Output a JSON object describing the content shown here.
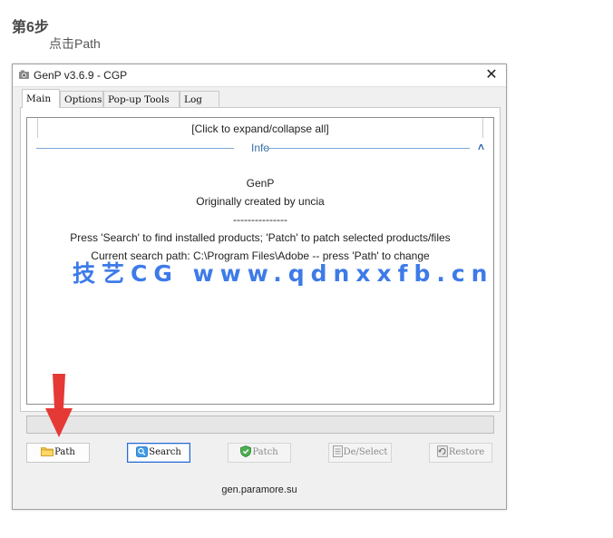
{
  "article": {
    "step_title": "第6步",
    "step_desc": "点击Path"
  },
  "window": {
    "title": "GenP v3.6.9 - CGP",
    "close_glyph": "✕"
  },
  "tabs": [
    {
      "label": "Main",
      "active": true
    },
    {
      "label": "Options",
      "active": false
    },
    {
      "label": "Pop-up Tools",
      "active": false
    },
    {
      "label": "Log",
      "active": false
    }
  ],
  "memo": {
    "expand_all": "[Click to expand/collapse all]",
    "info_label": "Info",
    "chevron_glyph": "˄",
    "lines": [
      "GenP",
      "Originally created by uncia",
      "---------------",
      "Press 'Search' to find installed products; 'Patch' to patch selected products/files",
      "Current search path: C:\\Program Files\\Adobe -- press 'Path' to change"
    ]
  },
  "progress": {
    "value_percent": 0
  },
  "buttons": {
    "path": "Path",
    "search": "Search",
    "patch": "Patch",
    "deselect": "De/Select",
    "restore": "Restore"
  },
  "footer": {
    "text": "gen.paramore.su"
  },
  "watermark": {
    "text": "技艺CG www.qdnxxfb.cn"
  },
  "colors": {
    "watermark": "#3d7be8",
    "annotation_arrow": "#e53935",
    "focus_border": "#2a6ad2"
  }
}
